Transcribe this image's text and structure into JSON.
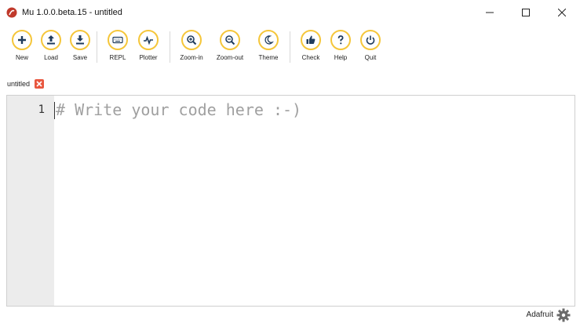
{
  "window": {
    "title": "Mu 1.0.0.beta.15 - untitled"
  },
  "toolbar": {
    "buttons": [
      {
        "label": "New",
        "icon": "plus-icon"
      },
      {
        "label": "Load",
        "icon": "upload-icon"
      },
      {
        "label": "Save",
        "icon": "download-icon"
      },
      {
        "label": "REPL",
        "icon": "keyboard-icon"
      },
      {
        "label": "Plotter",
        "icon": "pulse-icon"
      },
      {
        "label": "Zoom-in",
        "icon": "zoom-in-icon"
      },
      {
        "label": "Zoom-out",
        "icon": "zoom-out-icon"
      },
      {
        "label": "Theme",
        "icon": "moon-icon"
      },
      {
        "label": "Check",
        "icon": "thumbs-up-icon"
      },
      {
        "label": "Help",
        "icon": "question-icon"
      },
      {
        "label": "Quit",
        "icon": "power-icon"
      }
    ],
    "accent_color": "#f5c63a"
  },
  "tabs": [
    {
      "label": "untitled",
      "close_color": "#e8573f"
    }
  ],
  "editor": {
    "lines": [
      {
        "number": "1",
        "text": "# Write your code here :-)"
      }
    ]
  },
  "status": {
    "mode": "Adafruit"
  }
}
